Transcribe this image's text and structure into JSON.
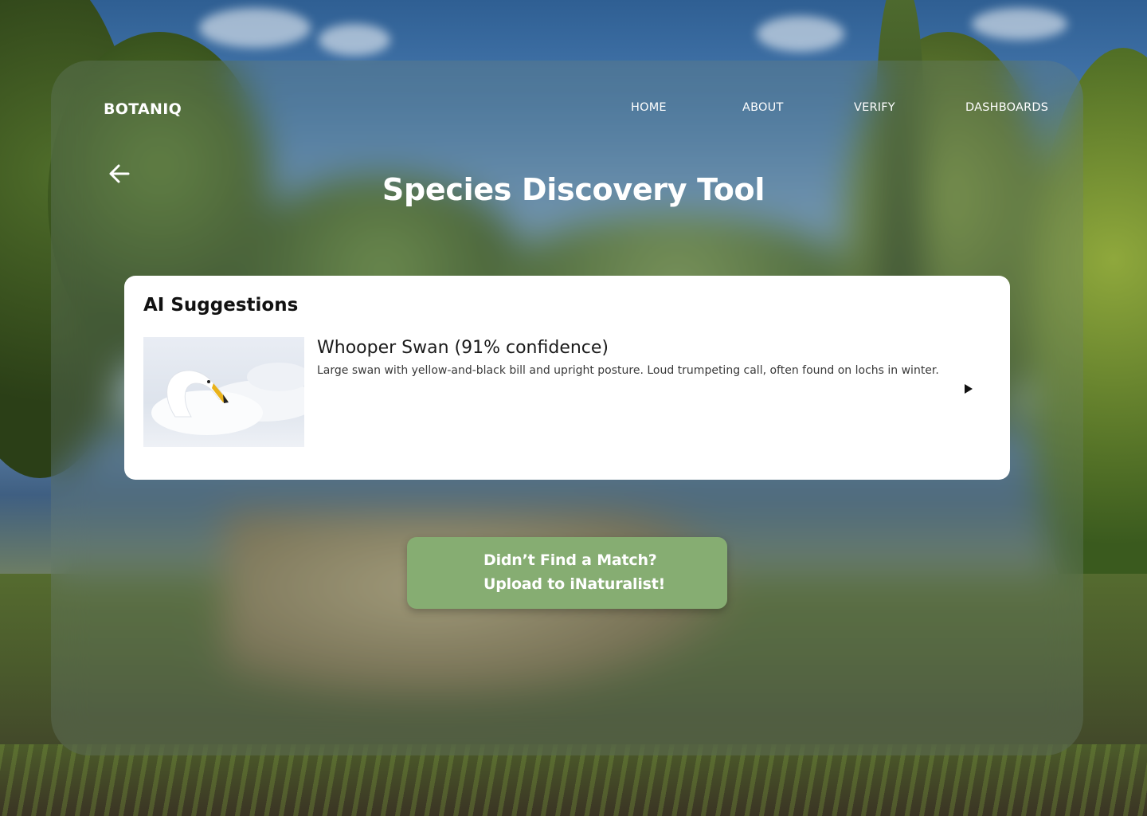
{
  "brand": {
    "name": "BOTANIQ"
  },
  "nav": {
    "items": [
      {
        "label": "HOME"
      },
      {
        "label": "ABOUT"
      },
      {
        "label": "VERIFY"
      },
      {
        "label": "DASHBOARDS"
      }
    ]
  },
  "page": {
    "title": "Species Discovery Tool"
  },
  "suggestions": {
    "heading": "AI Suggestions",
    "items": [
      {
        "name": "Whooper Swan (91% confidence)",
        "description": "Large swan with yellow-and-black bill and upright posture. Loud trumpeting call, often found on lochs in winter."
      }
    ]
  },
  "cta": {
    "line1": "Didn’t Find a Match?",
    "line2": "Upload to iNaturalist!"
  },
  "icons": {
    "back": "arrow-left-icon",
    "expand": "play-triangle-icon"
  },
  "colors": {
    "cta_background": "#86ad72",
    "card_background": "#ffffff",
    "text_on_glass": "#ffffff"
  }
}
